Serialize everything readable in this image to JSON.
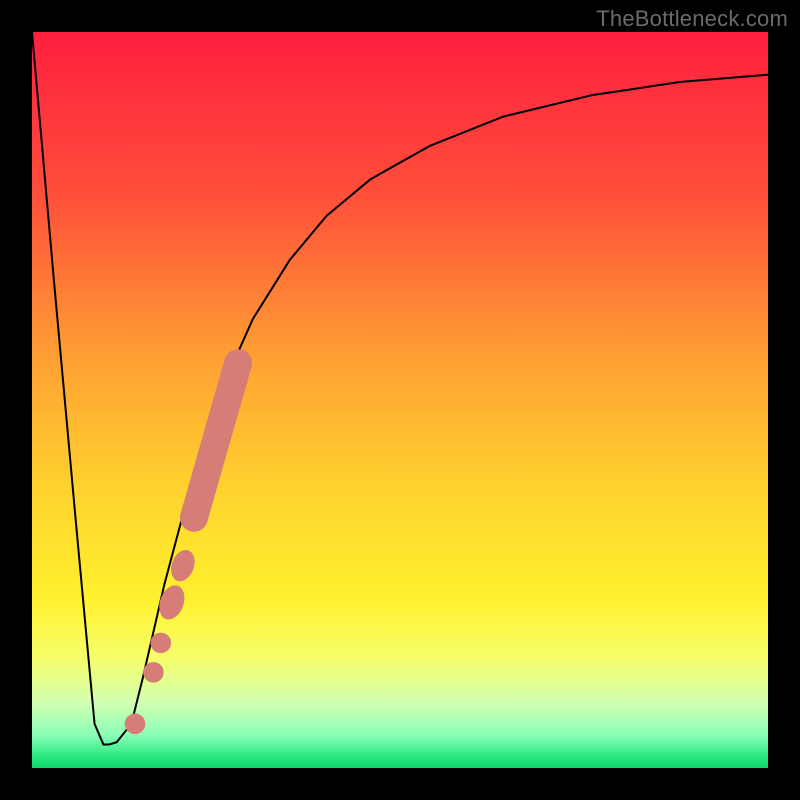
{
  "watermark": "TheBottleneck.com",
  "chart_data": {
    "type": "line",
    "title": "",
    "xlabel": "",
    "ylabel": "",
    "xlim": [
      0,
      100
    ],
    "ylim": [
      0,
      100
    ],
    "grid": false,
    "legend": false,
    "gradient_stops": [
      {
        "offset": 0.0,
        "color": "#ff1f3f"
      },
      {
        "offset": 0.22,
        "color": "#ff4e3a"
      },
      {
        "offset": 0.45,
        "color": "#ffa233"
      },
      {
        "offset": 0.62,
        "color": "#ffd22e"
      },
      {
        "offset": 0.77,
        "color": "#fff12e"
      },
      {
        "offset": 0.85,
        "color": "#f6ff6a"
      },
      {
        "offset": 0.91,
        "color": "#d3ffb0"
      },
      {
        "offset": 0.955,
        "color": "#8bffb8"
      },
      {
        "offset": 0.985,
        "color": "#27e87e"
      },
      {
        "offset": 1.0,
        "color": "#0fd76c"
      }
    ],
    "series": [
      {
        "name": "bottleneck-curve",
        "x": [
          0,
          3,
          6,
          8.5,
          9.7,
          10.5,
          11.5,
          13.5,
          15,
          18,
          22,
          26,
          30,
          35,
          40,
          46,
          54,
          64,
          76,
          88,
          100
        ],
        "y": [
          100,
          66,
          33,
          6,
          3.2,
          3.2,
          3.5,
          6,
          12,
          25,
          40,
          52,
          61,
          69,
          75,
          80,
          84.5,
          88.5,
          91.4,
          93.2,
          94.2
        ]
      }
    ],
    "markers": [
      {
        "shape": "circle",
        "x": 14.0,
        "y": 6.0,
        "r": 1.4
      },
      {
        "shape": "circle",
        "x": 16.5,
        "y": 13.0,
        "r": 1.4
      },
      {
        "shape": "circle",
        "x": 17.5,
        "y": 17.0,
        "r": 1.4
      },
      {
        "shape": "ellipse",
        "x": 19.0,
        "y": 22.5,
        "rx": 1.6,
        "ry": 2.4,
        "angle": 20
      },
      {
        "shape": "ellipse",
        "x": 20.5,
        "y": 27.5,
        "rx": 1.5,
        "ry": 2.2,
        "angle": 20
      },
      {
        "shape": "capsule",
        "x1": 22.0,
        "y1": 34.0,
        "x2": 28.0,
        "y2": 55.0,
        "w": 3.8
      }
    ],
    "marker_color": "#d57d76"
  }
}
